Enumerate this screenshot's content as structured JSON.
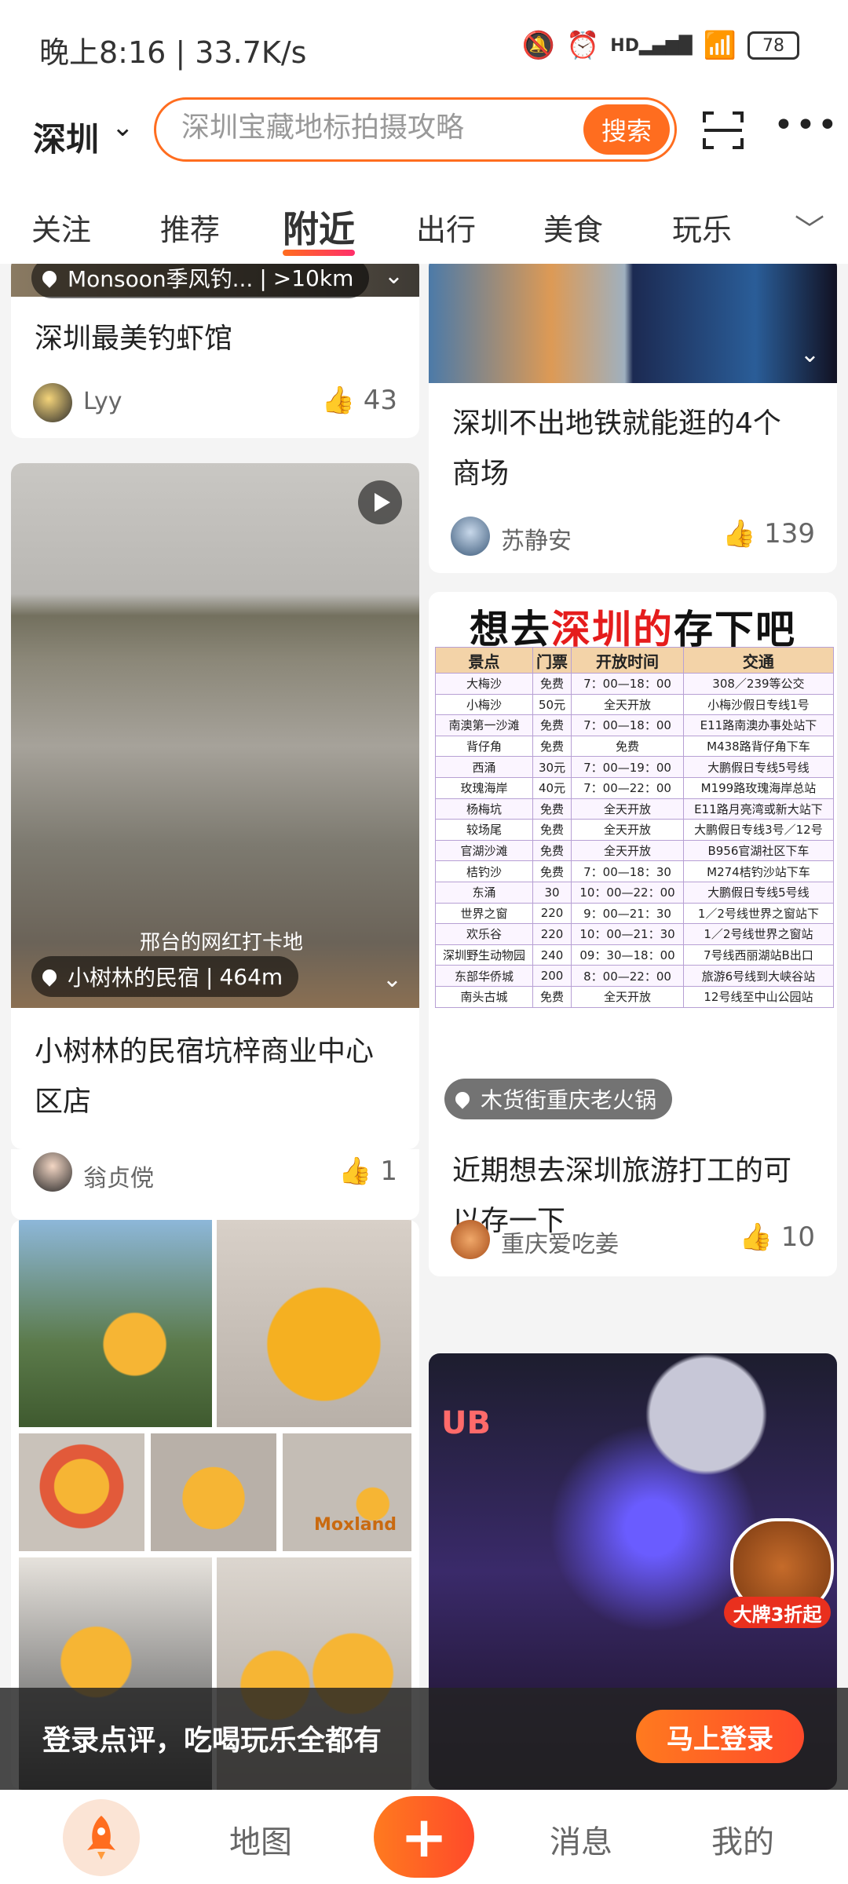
{
  "status_bar": {
    "time": "晚上8:16 | 33.7K/s",
    "battery": "78",
    "signal_label": "HD"
  },
  "header": {
    "city": "深圳",
    "search_placeholder": "深圳宝藏地标拍摄攻略",
    "search_button": "搜索"
  },
  "tabs": [
    "关注",
    "推荐",
    "附近",
    "出行",
    "美食",
    "玩乐"
  ],
  "active_tab": "附近",
  "feed": {
    "card1": {
      "location": "Monsoon季风钓...",
      "distance": ">10km",
      "title": "深圳最美钓虾馆",
      "user": "Lyy",
      "likes": "43"
    },
    "card2": {
      "title_line1": "深圳不出地铁就能逛的4个",
      "title_line2": "商场",
      "user": "苏静安",
      "likes": "139"
    },
    "card3": {
      "overlay_text": "邢台的网红打卡地",
      "location": "小树林的民宿",
      "distance": "464m",
      "title_line1": "小树林的民宿坑梓商业中心",
      "title_line2": "区店",
      "user": "翁贞傥",
      "likes": "1"
    },
    "card4": {
      "poster_title_a": "想去",
      "poster_title_b": "深圳的",
      "poster_title_c": "存下吧",
      "table_headers": [
        "景点",
        "门票",
        "开放时间",
        "交通"
      ],
      "table_rows": [
        [
          "大梅沙",
          "免费",
          "7：00—18：00",
          "308／239等公交"
        ],
        [
          "小梅沙",
          "50元",
          "全天开放",
          "小梅沙假日专线1号"
        ],
        [
          "南澳第一沙滩",
          "免费",
          "7：00—18：00",
          "E11路南澳办事处站下"
        ],
        [
          "背仔角",
          "免费",
          "免费",
          "M438路背仔角下车"
        ],
        [
          "西涌",
          "30元",
          "7：00—19：00",
          "大鹏假日专线5号线"
        ],
        [
          "玫瑰海岸",
          "40元",
          "7：00—22：00",
          "M199路玫瑰海岸总站"
        ],
        [
          "杨梅坑",
          "免费",
          "全天开放",
          "E11路月亮湾或新大站下"
        ],
        [
          "较场尾",
          "免费",
          "全天开放",
          "大鹏假日专线3号／12号"
        ],
        [
          "官湖沙滩",
          "免费",
          "全天开放",
          "B956官湖社区下车"
        ],
        [
          "桔钓沙",
          "免费",
          "7：00—18：30",
          "M274桔钓沙站下车"
        ],
        [
          "东涌",
          "30",
          "10：00—22：00",
          "大鹏假日专线5号线"
        ],
        [
          "世界之窗",
          "220",
          "9：00—21：30",
          "1／2号线世界之窗站下"
        ],
        [
          "欢乐谷",
          "220",
          "10：00—21：30",
          "1／2号线世界之窗站"
        ],
        [
          "深圳野生动物园",
          "240",
          "09：30—18：00",
          "7号线西丽湖站B出口"
        ],
        [
          "东部华侨城",
          "200",
          "8：00—22：00",
          "旅游6号线到大峡谷站"
        ],
        [
          "南头古城",
          "免费",
          "全天开放",
          "12号线至中山公园站"
        ]
      ],
      "location": "木货街重庆老火锅",
      "title_line1": "近期想去深圳旅游打工的可",
      "title_line2": "以存一下",
      "user": "重庆爱吃姜",
      "likes": "10"
    },
    "card5": {
      "overlay_text": "Moxland"
    },
    "card6": {
      "badge": "大牌3折起",
      "neon": "UB"
    }
  },
  "login_banner": {
    "text": "登录点评，吃喝玩乐全都有",
    "button": "马上登录"
  },
  "bottom_nav": {
    "map": "地图",
    "messages": "消息",
    "mine": "我的"
  },
  "colors": {
    "accent": "#ff6d1f",
    "accent2": "#ff2f6a"
  }
}
